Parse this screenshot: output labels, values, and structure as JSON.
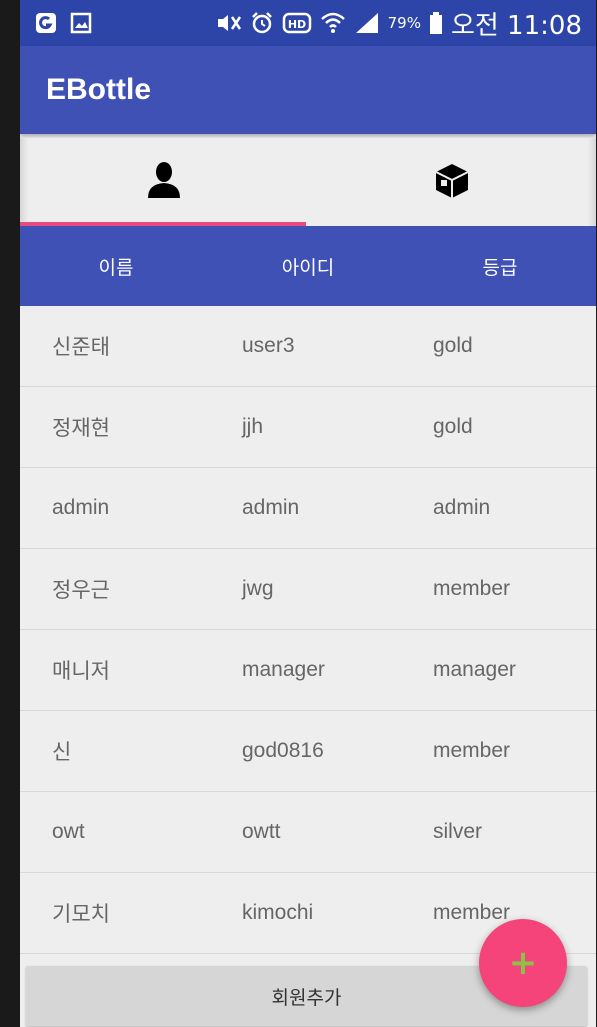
{
  "status_bar": {
    "battery_percent": "79%",
    "time": "오전 11:08",
    "icons": [
      "g-app-icon",
      "gallery-icon",
      "mute-icon",
      "alarm-icon",
      "hd-icon",
      "wifi-icon",
      "signal-icon",
      "battery-icon"
    ]
  },
  "app_bar": {
    "title": "EBottle"
  },
  "tabs": [
    {
      "icon": "person-icon",
      "selected": true
    },
    {
      "icon": "box-icon",
      "selected": false
    }
  ],
  "table": {
    "headers": [
      "이름",
      "아이디",
      "등급"
    ],
    "rows": [
      [
        "신준태",
        "user3",
        "gold"
      ],
      [
        "정재현",
        "jjh",
        "gold"
      ],
      [
        "admin",
        "admin",
        "admin"
      ],
      [
        "정우근",
        "jwg",
        "member"
      ],
      [
        "매니저",
        "manager",
        "manager"
      ],
      [
        "신",
        "god0816",
        "member"
      ],
      [
        "owt",
        "owtt",
        "silver"
      ],
      [
        "기모치",
        "kimochi",
        "member"
      ]
    ]
  },
  "add_member_button": {
    "label": "회원추가"
  },
  "fab": {
    "label": "+"
  },
  "colors": {
    "status_bar": "#2d45a8",
    "primary": "#3f51b5",
    "accent": "#f4447a",
    "tab_indicator": "#e84a7d",
    "fab_plus": "#8bc34a"
  }
}
